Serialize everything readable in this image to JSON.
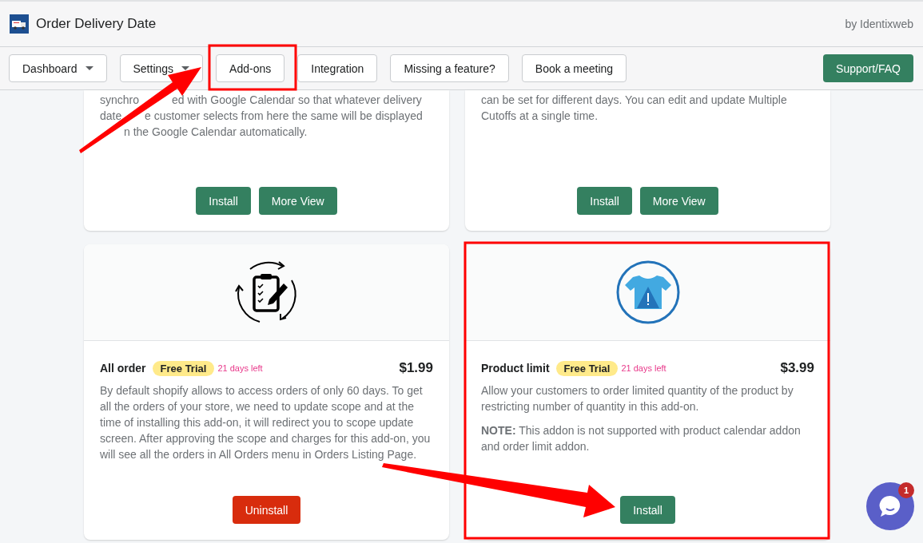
{
  "header": {
    "app_title": "Order Delivery Date",
    "by_text": "by Identixweb"
  },
  "nav": {
    "items": [
      {
        "label": "Dashboard",
        "dropdown": true
      },
      {
        "label": "Settings",
        "dropdown": true
      },
      {
        "label": "Add-ons",
        "dropdown": false
      },
      {
        "label": "Integration",
        "dropdown": false
      },
      {
        "label": "Missing a feature?",
        "dropdown": false
      },
      {
        "label": "Book a meeting",
        "dropdown": false
      }
    ],
    "support": "Support/FAQ"
  },
  "top_cards": [
    {
      "lines": [
        [
          "synchro",
          "ed with Google Calendar so that whatever delivery"
        ],
        [
          "date",
          "e customer selects from here the same will be displayed"
        ],
        [
          "n the Google Calendar automatically."
        ]
      ],
      "buttons": [
        "Install",
        "More View"
      ]
    },
    {
      "lines": [
        [
          "can be set for different days. You can edit and update Multiple"
        ],
        [
          "Cutoffs at a single time."
        ]
      ],
      "buttons": [
        "Install",
        "More View"
      ]
    }
  ],
  "addons": [
    {
      "kind": "clipboard",
      "title": "All order",
      "badge": "Free Trial",
      "days_left": "21 days left",
      "price": "$1.99",
      "paragraphs": [
        "By default shopify allows to access orders of only 60 days. To get all the orders of your store, we need to update scope and at the time of installing this add-on, it will redirect you to scope update screen. After approving the scope and charges for this add-on, you will see all the orders in All Orders menu in Orders Listing Page."
      ],
      "button": {
        "label": "Uninstall",
        "kind": "destructive"
      }
    },
    {
      "kind": "shirt",
      "title": "Product limit",
      "badge": "Free Trial",
      "days_left": "21 days left",
      "price": "$3.99",
      "paragraphs": [
        "Allow your customers to order limited quantity of the product by restricting number of quantity in this add-on.",
        "**NOTE:** This addon is not supported with product calendar addon and order limit addon."
      ],
      "button": {
        "label": "Install",
        "kind": "primary"
      }
    }
  ],
  "chat": {
    "unread": "1"
  }
}
